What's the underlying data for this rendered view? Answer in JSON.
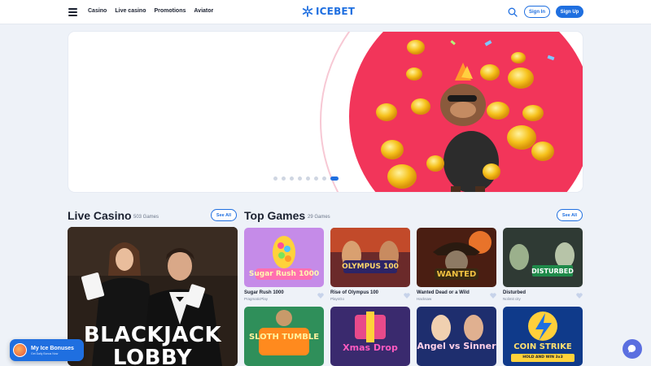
{
  "header": {
    "nav": [
      "Casino",
      "Live casino",
      "Promotions",
      "Aviator"
    ],
    "logo_text": "ICEBET",
    "signin_label": "Sign In",
    "signup_label": "Sign Up"
  },
  "hero": {
    "slides_count": 8,
    "active_slide": 8
  },
  "live_casino": {
    "title": "Live Casino",
    "count": "503 Games",
    "see_all": "See All",
    "featured_title_line1": "BLACKJACK",
    "featured_title_line2": "LOBBY"
  },
  "top_games": {
    "title": "Top Games",
    "count": "29 Games",
    "see_all": "See All",
    "row1": [
      {
        "name": "Sugar Rush 1000",
        "provider": "PragmaticPlay",
        "thumb_text": "Sugar Rush 1000"
      },
      {
        "name": "Rise of Olympus 100",
        "provider": "PlaysGo",
        "thumb_text": "OLYMPUS 100"
      },
      {
        "name": "Wanted Dead or a Wild",
        "provider": "Hacksaw",
        "thumb_text": "WANTED"
      },
      {
        "name": "Disturbed",
        "provider": "Nolimit city",
        "thumb_text": "DISTURBED"
      }
    ],
    "row2_thumbs": [
      "SLOTH TUMBLE",
      "Xmas Drop",
      "Angel vs Sinner",
      "COIN STRIKE"
    ],
    "coin_strike_sub": "HOLD AND WIN 3x3"
  },
  "bonus": {
    "title": "My Ice Bonuses",
    "subtitle": "Get Daily Bonus Now"
  },
  "colors": {
    "brand": "#1f6fe0",
    "background": "#eef2f8",
    "hero_accent": "#f2355a"
  }
}
